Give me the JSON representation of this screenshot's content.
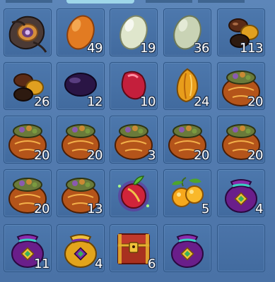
{
  "inventory": {
    "slots": [
      {
        "icon": "amulet-icon",
        "qty": ""
      },
      {
        "icon": "orange-egg-icon",
        "qty": "49"
      },
      {
        "icon": "white-egg-icon",
        "qty": "19"
      },
      {
        "icon": "green-egg-icon",
        "qty": "36"
      },
      {
        "icon": "seeds-bundle-icon",
        "qty": "113"
      },
      {
        "icon": "seeds-bundle-icon",
        "qty": "26"
      },
      {
        "icon": "dark-plum-icon",
        "qty": "12"
      },
      {
        "icon": "red-gem-icon",
        "qty": "10"
      },
      {
        "icon": "golden-seed-icon",
        "qty": "24"
      },
      {
        "icon": "loot-sack-icon",
        "qty": "20"
      },
      {
        "icon": "loot-sack-icon",
        "qty": "20"
      },
      {
        "icon": "loot-sack-icon",
        "qty": "20"
      },
      {
        "icon": "loot-sack-icon",
        "qty": "3"
      },
      {
        "icon": "loot-sack-icon",
        "qty": "20"
      },
      {
        "icon": "loot-sack-icon",
        "qty": "20"
      },
      {
        "icon": "loot-sack-icon",
        "qty": "20"
      },
      {
        "icon": "loot-sack-icon",
        "qty": "13"
      },
      {
        "icon": "magic-fruit-icon",
        "qty": ""
      },
      {
        "icon": "lemons-icon",
        "qty": "5"
      },
      {
        "icon": "purple-pouch-icon",
        "qty": "4"
      },
      {
        "icon": "purple-pouch-icon",
        "qty": "11"
      },
      {
        "icon": "golden-pouch-icon",
        "qty": "4"
      },
      {
        "icon": "treasure-chest-icon",
        "qty": "6"
      },
      {
        "icon": "purple-pouch-icon",
        "qty": ""
      },
      {
        "icon": "",
        "qty": ""
      }
    ]
  },
  "colors": {
    "background": "#4f76a8",
    "slot": "#4a74a8",
    "qty_text": "#ffffff"
  }
}
